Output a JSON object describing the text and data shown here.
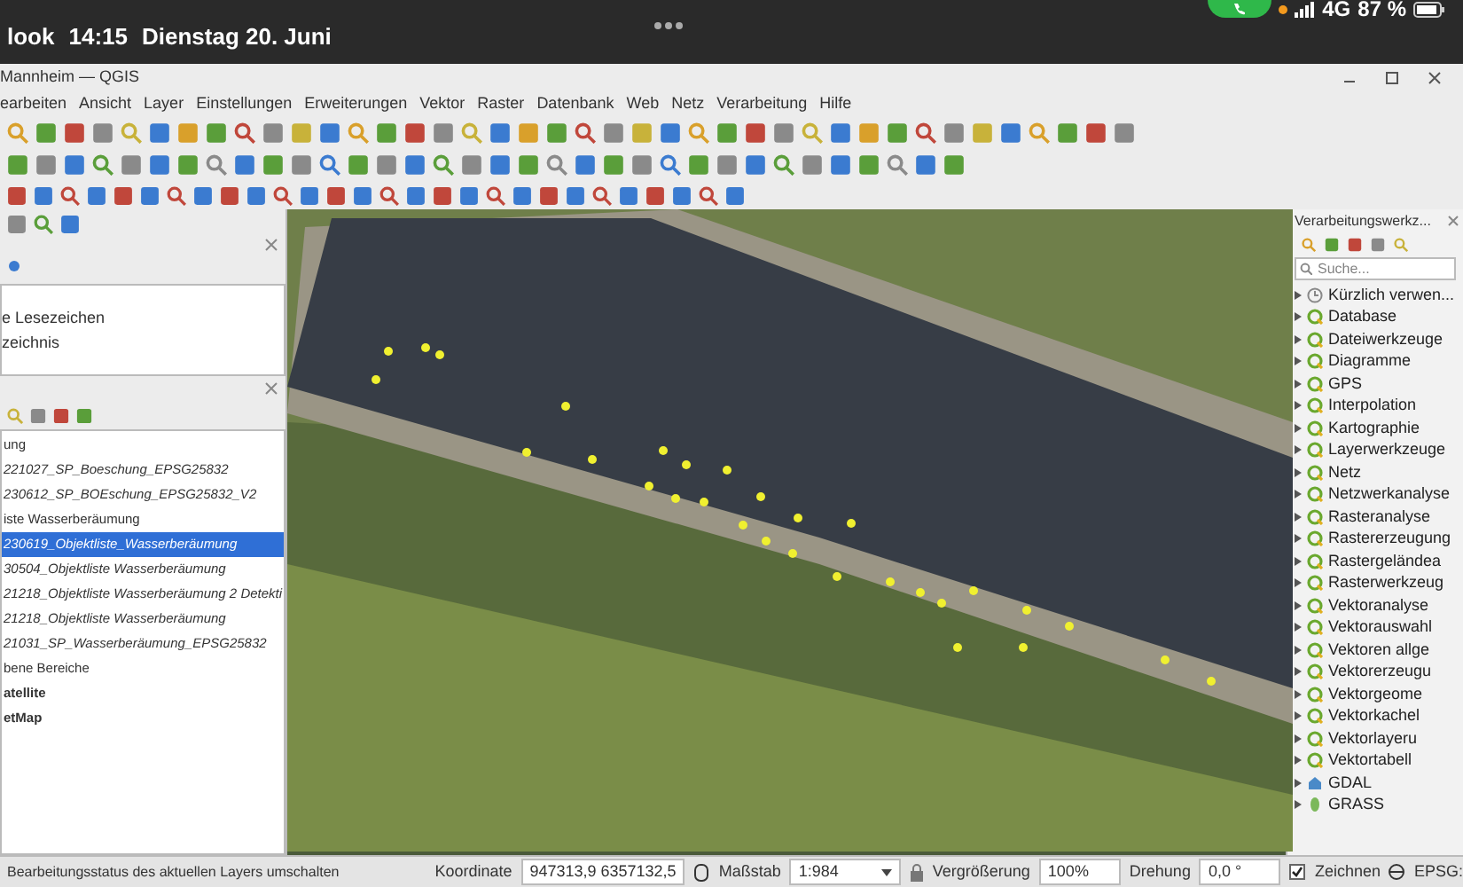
{
  "phone_status": {
    "app": "look",
    "time": "14:15",
    "date": "Dienstag 20. Juni",
    "network": "4G",
    "battery": "87 %"
  },
  "window": {
    "title": "Mannheim — QGIS"
  },
  "menu": [
    "earbeiten",
    "Ansicht",
    "Layer",
    "Einstellungen",
    "Erweiterungen",
    "Vektor",
    "Raster",
    "Datenbank",
    "Web",
    "Netz",
    "Verarbeitung",
    "Hilfe"
  ],
  "browser": {
    "items": [
      "e Lesezeichen",
      "zeichnis"
    ]
  },
  "layers": [
    {
      "label": "ung",
      "kind": "group",
      "selected": false
    },
    {
      "label": "221027_SP_Boeschung_EPSG25832",
      "kind": "layer",
      "selected": false
    },
    {
      "label": "230612_SP_BOEschung_EPSG25832_V2",
      "kind": "layer",
      "selected": false
    },
    {
      "label": "iste Wasserberäumung",
      "kind": "group",
      "selected": false
    },
    {
      "label": "230619_Objektliste_Wasserberäumung",
      "kind": "layer",
      "selected": true
    },
    {
      "label": "30504_Objektliste Wasserberäumung",
      "kind": "layer",
      "selected": false
    },
    {
      "label": "21218_Objektliste Wasserberäumung 2 Detekti",
      "kind": "layer",
      "selected": false
    },
    {
      "label": "21218_Objektliste Wasserberäumung",
      "kind": "layer",
      "selected": false
    },
    {
      "label": "21031_SP_Wasserberäumung_EPSG25832",
      "kind": "layer",
      "selected": false
    },
    {
      "label": "bene Bereiche",
      "kind": "group",
      "selected": false
    },
    {
      "label": "atellite",
      "kind": "basemap",
      "selected": false
    },
    {
      "label": "etMap",
      "kind": "basemap",
      "selected": false
    }
  ],
  "processing": {
    "title": "Verarbeitungswerkz...",
    "search": {
      "placeholder": "Suche..."
    },
    "items": [
      {
        "label": "Kürzlich verwen...",
        "kind": "recent"
      },
      {
        "label": "Database",
        "kind": "provider"
      },
      {
        "label": "Dateiwerkzeuge",
        "kind": "provider"
      },
      {
        "label": "Diagramme",
        "kind": "provider"
      },
      {
        "label": "GPS",
        "kind": "provider"
      },
      {
        "label": "Interpolation",
        "kind": "provider"
      },
      {
        "label": "Kartographie",
        "kind": "provider"
      },
      {
        "label": "Layerwerkzeuge",
        "kind": "provider"
      },
      {
        "label": "Netz",
        "kind": "provider"
      },
      {
        "label": "Netzwerkanalyse",
        "kind": "provider"
      },
      {
        "label": "Rasteranalyse",
        "kind": "provider"
      },
      {
        "label": "Rastererzeugung",
        "kind": "provider"
      },
      {
        "label": "Rastergeländea",
        "kind": "provider"
      },
      {
        "label": "Rasterwerkzeug",
        "kind": "provider"
      },
      {
        "label": "Vektoranalyse",
        "kind": "provider"
      },
      {
        "label": "Vektorauswahl",
        "kind": "provider"
      },
      {
        "label": "Vektoren allge",
        "kind": "provider"
      },
      {
        "label": "Vektorerzeugu",
        "kind": "provider"
      },
      {
        "label": "Vektorgeome",
        "kind": "provider"
      },
      {
        "label": "Vektorkachel",
        "kind": "provider"
      },
      {
        "label": "Vektorlayeru",
        "kind": "provider"
      },
      {
        "label": "Vektortabell",
        "kind": "provider"
      },
      {
        "label": "GDAL",
        "kind": "gdal"
      },
      {
        "label": "GRASS",
        "kind": "grass"
      }
    ]
  },
  "status_bar": {
    "message": "Bearbeitungsstatus des aktuellen Layers umschalten",
    "coordinate_label": "Koordinate",
    "coordinate": "947313,9  6357132,5",
    "scale_label": "Maßstab",
    "scale": "1:984",
    "magnifier_label": "Vergrößerung",
    "magnifier": "100%",
    "rotation_label": "Drehung",
    "rotation": "0,0 °",
    "render": {
      "label": "Zeichnen",
      "checked": true
    },
    "crs": "EPSG:"
  }
}
